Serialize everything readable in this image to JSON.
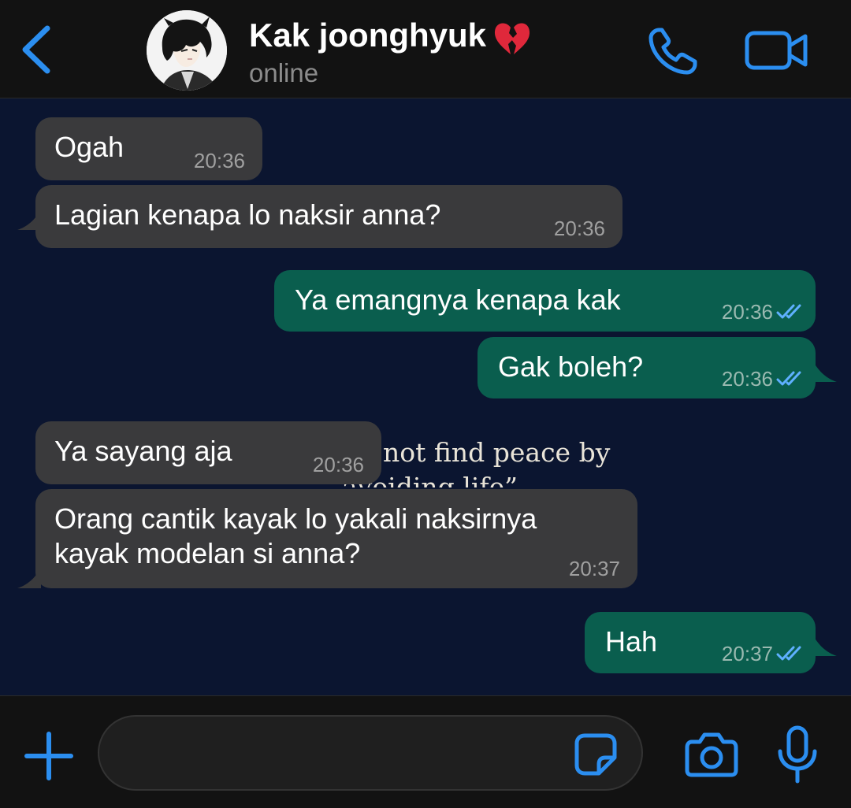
{
  "colors": {
    "accent": "#2b8ef0",
    "incoming_bubble": "#3a3a3c",
    "outgoing_bubble": "#0a5e4e",
    "chat_background": "#0b1530",
    "bar_background": "#121212",
    "read_ticks": "#5fb0ff"
  },
  "header": {
    "back_icon": "chevron-left-icon",
    "contact_name": "Kak joonghyuk",
    "contact_emoji": "broken-heart-emoji",
    "status": "online",
    "call_icon": "phone-icon",
    "video_icon": "video-camera-icon"
  },
  "wallpaper": {
    "line1": "not find peace by",
    "line2": "avoiding life”"
  },
  "messages": [
    {
      "direction": "incoming",
      "text": "Ogah",
      "time": "20:36"
    },
    {
      "direction": "incoming",
      "text": "Lagian kenapa lo naksir anna?",
      "time": "20:36"
    },
    {
      "direction": "outgoing",
      "text": "Ya emangnya kenapa kak",
      "time": "20:36",
      "status": "read"
    },
    {
      "direction": "outgoing",
      "text": "Gak boleh?",
      "time": "20:36",
      "status": "read"
    },
    {
      "direction": "incoming",
      "text": "Ya sayang aja",
      "time": "20:36"
    },
    {
      "direction": "incoming",
      "text": "Orang cantik kayak lo yakali naksirnya\nkayak modelan si anna?",
      "time": "20:37"
    },
    {
      "direction": "outgoing",
      "text": "Hah",
      "time": "20:37",
      "status": "read"
    }
  ],
  "footer": {
    "attach_icon": "plus-icon",
    "input_value": "",
    "sticker_icon": "sticker-icon",
    "camera_icon": "camera-icon",
    "mic_icon": "microphone-icon"
  }
}
